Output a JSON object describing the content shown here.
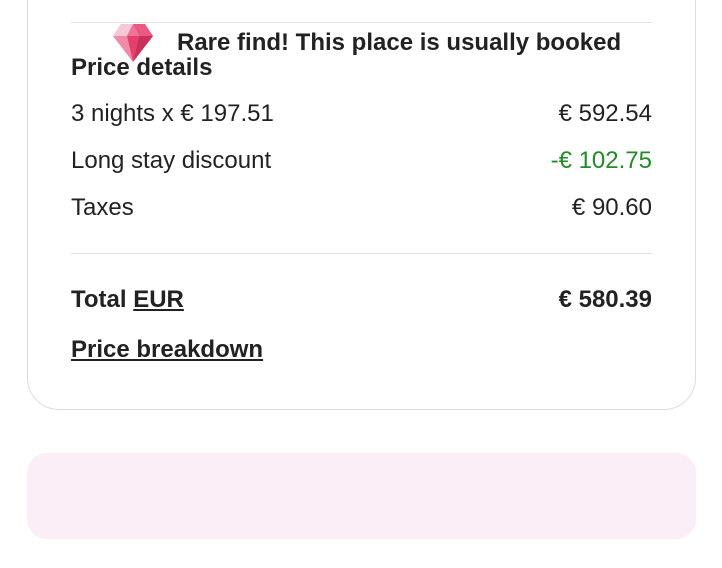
{
  "price_details": {
    "heading": "Price details",
    "lines": [
      {
        "label": "3 nights x € 197.51",
        "value": "€ 592.54"
      },
      {
        "label": "Long stay discount",
        "value": "-€ 102.75"
      },
      {
        "label": "Taxes",
        "value": "€ 90.60"
      }
    ],
    "total": {
      "label": "Total",
      "currency": "EUR",
      "value": "€ 580.39"
    },
    "breakdown_link": "Price breakdown"
  },
  "banner": {
    "text": "Rare find! This place is usually booked",
    "icon": "diamond-icon",
    "background": "#fbeef6",
    "icon_color": "#e4406b"
  },
  "colors": {
    "discount": "#238a28",
    "text": "#222222"
  }
}
